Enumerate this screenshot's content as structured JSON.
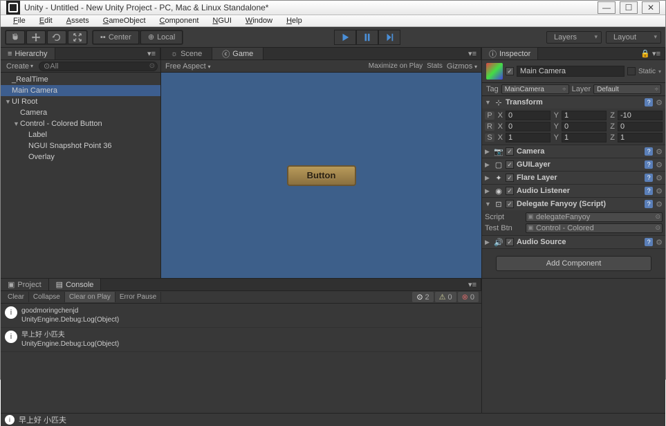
{
  "window": {
    "title": "Unity - Untitled - New Unity Project - PC, Mac & Linux Standalone*"
  },
  "menubar": {
    "items": [
      "File",
      "Edit",
      "Assets",
      "GameObject",
      "Component",
      "NGUI",
      "Window",
      "Help"
    ]
  },
  "toolbar": {
    "center": "Center",
    "local": "Local",
    "layers": "Layers",
    "layout": "Layout"
  },
  "hierarchy": {
    "tab": "Hierarchy",
    "create": "Create",
    "search_placeholder": "All",
    "items": [
      {
        "name": "_RealTime",
        "depth": 0,
        "selected": false,
        "arrow": ""
      },
      {
        "name": "Main Camera",
        "depth": 0,
        "selected": true,
        "arrow": ""
      },
      {
        "name": "UI Root",
        "depth": 0,
        "selected": false,
        "arrow": "▼"
      },
      {
        "name": "Camera",
        "depth": 1,
        "selected": false,
        "arrow": ""
      },
      {
        "name": "Control - Colored Button",
        "depth": 1,
        "selected": false,
        "arrow": "▼"
      },
      {
        "name": "Label",
        "depth": 2,
        "selected": false,
        "arrow": ""
      },
      {
        "name": "NGUI Snapshot Point 36",
        "depth": 2,
        "selected": false,
        "arrow": ""
      },
      {
        "name": "Overlay",
        "depth": 2,
        "selected": false,
        "arrow": ""
      }
    ]
  },
  "center": {
    "scene_tab": "Scene",
    "game_tab": "Game",
    "free_aspect": "Free Aspect",
    "maximize": "Maximize on Play",
    "stats": "Stats",
    "gizmos": "Gizmos",
    "button_label": "Button"
  },
  "inspector": {
    "tab": "Inspector",
    "object_name": "Main Camera",
    "static": "Static",
    "tag_label": "Tag",
    "tag_value": "MainCamera",
    "layer_label": "Layer",
    "layer_value": "Default",
    "transform": {
      "name": "Transform",
      "rows": [
        {
          "label": "P",
          "x": "0",
          "y": "1",
          "z": "-10"
        },
        {
          "label": "R",
          "x": "0",
          "y": "0",
          "z": "0"
        },
        {
          "label": "S",
          "x": "1",
          "y": "1",
          "z": "1"
        }
      ]
    },
    "components": [
      {
        "name": "Camera",
        "icon": "📷",
        "expanded": false,
        "checked": true
      },
      {
        "name": "GUILayer",
        "icon": "▢",
        "expanded": false,
        "checked": true
      },
      {
        "name": "Flare Layer",
        "icon": "✦",
        "expanded": false,
        "checked": true
      },
      {
        "name": "Audio Listener",
        "icon": "◉",
        "expanded": false,
        "checked": true
      }
    ],
    "delegate": {
      "name": "Delegate Fanyoy (Script)",
      "script_label": "Script",
      "script_value": "delegateFanyoy",
      "testbtn_label": "Test Btn",
      "testbtn_value": "Control - Colored"
    },
    "audio_source": "Audio Source",
    "add_component": "Add Component"
  },
  "bottom": {
    "project_tab": "Project",
    "console_tab": "Console",
    "clear": "Clear",
    "collapse": "Collapse",
    "clear_on_play": "Clear on Play",
    "error_pause": "Error Pause",
    "badge_info": "2",
    "badge_warn": "0",
    "badge_err": "0",
    "logs": [
      {
        "msg": "goodmoringchenjd",
        "trace": "UnityEngine.Debug:Log(Object)"
      },
      {
        "msg": "早上好 小匹夫",
        "trace": "UnityEngine.Debug:Log(Object)"
      }
    ]
  },
  "statusbar": {
    "msg": "早上好 小匹夫"
  }
}
